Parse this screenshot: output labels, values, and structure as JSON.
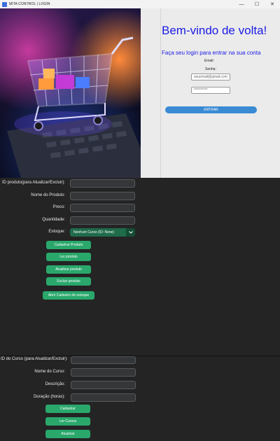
{
  "titlebar": {
    "title": "MITA CONTROL  |  LOGIN",
    "minimize": "—",
    "maximize": "☐",
    "close": "✕"
  },
  "login": {
    "welcome": "Bem-vindo de volta!",
    "subtitle": "Faça seu login para entrar na sua conta",
    "email_label": "Email:",
    "senha_label": "Senha:",
    "email_placeholder": "seuemail@gmail.com",
    "senha_value": "**********",
    "submit_label": "ENTRAR"
  },
  "produto_form": {
    "id_label": "ID produto(para Atualizar/Excluir):",
    "nome_label": "Nome do Produto:",
    "preco_label": "Preco:",
    "quantidade_label": "Quantidade:",
    "estoque_label": "Estoque:",
    "estoque_selected": "Nenhum Curso (ID: None)",
    "buttons": [
      "Cadastrar Produto",
      "Ler produto",
      "Atualizar produto",
      "Excluir produto"
    ],
    "abrir_button": "Abrir Cadastro de estoque"
  },
  "curso_form": {
    "id_label": "ID do Curso (para Atualizar/Excluir):",
    "nome_label": "Nome do Curso:",
    "descricao_label": "Descrição:",
    "duracao_label": "Duração (horas):",
    "buttons": [
      "Cadastrar",
      "Ler Cursos",
      "Atualizar"
    ]
  },
  "colors": {
    "accent_green": "#2aa86c",
    "combo_green": "#1f6b4a",
    "login_blue": "#1a1ae6",
    "entrar_blue": "#3a8ad4"
  },
  "icons": {
    "app": "app-icon",
    "hero": "shopping-cart-laptop-image",
    "dropdown": "chevron-down-icon"
  }
}
